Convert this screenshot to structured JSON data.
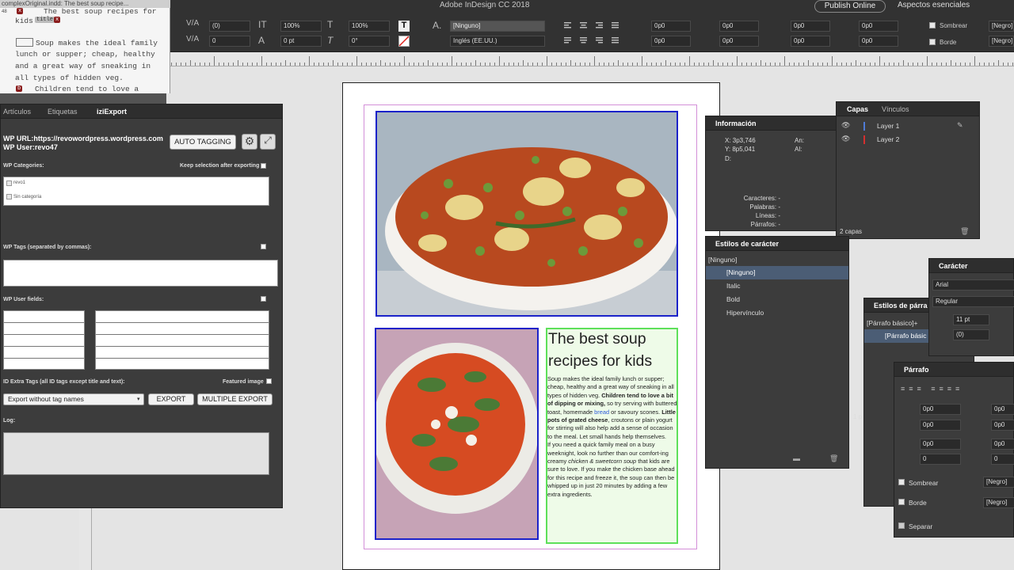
{
  "app": {
    "title": "Adobe InDesign CC 2018",
    "publish": "Publish Online",
    "workspace": "Aspectos esenciales"
  },
  "control": {
    "kern": "(0)",
    "track": "0",
    "scale_v": "100%",
    "scale_h": "100%",
    "baseline": "0 pt",
    "skew": "0°",
    "char_style": "[Ninguno]",
    "language": "Inglés (EE.UU.)",
    "indent_values": [
      "0p0",
      "0p0",
      "0p0",
      "0p0",
      "0p0",
      "0p0",
      "0p0",
      "0p0"
    ],
    "shade_label": "Sombrear",
    "border_label": "Borde",
    "color_label": "[Negro]"
  },
  "story_editor": {
    "title": "complexOriginal.indd: The best soup recipe...",
    "row0_number": "48",
    "lines": [
      "The best soup recipes for",
      "kids",
      "Soup makes the ideal family",
      "lunch or supper; cheap, healthy",
      "and a great way of sneaking in",
      "all types of hidden veg.",
      "Children tend to love a"
    ],
    "tags": {
      "title_tag": "title",
      "b_tag": "b"
    }
  },
  "izi": {
    "tabs": [
      "Artículos",
      "Etiquetas",
      "iziExport"
    ],
    "wp_url": "WP URL:https://revowordpress.wordpress.com",
    "wp_user": "WP User:revo47",
    "auto_tagging": "AUTO TAGGING",
    "categories_label": "WP Categories:",
    "keep_selection": "Keep selection after exporting",
    "categories": [
      "revo1",
      "Sin categoría"
    ],
    "tags_label": "WP Tags (separated by commas):",
    "user_fields_label": "WP User fields:",
    "extra_tags_label": "ID Extra Tags (all ID tags except title and text):",
    "featured_image": "Featured image",
    "export_select": "Export without tag names",
    "export_btn": "EXPORT",
    "multiple_export_btn": "MULTIPLE EXPORT",
    "log_label": "Log:"
  },
  "info": {
    "title": "Información",
    "x": "X: 3p3,746",
    "y": "Y: 8p5,041",
    "d": "D:",
    "an": "An:",
    "al": "Al:",
    "stats": [
      "Caracteres: -",
      "Palabras: -",
      "Líneas: -",
      "Párrafos: -"
    ]
  },
  "layers": {
    "tabs": [
      "Capas",
      "Vínculos"
    ],
    "items": [
      {
        "name": "Layer 1",
        "color": "#4f7bd6"
      },
      {
        "name": "Layer 2",
        "color": "#d62f2f"
      }
    ],
    "count": "2 capas"
  },
  "char_styles": {
    "title": "Estilos de carácter",
    "current": "[Ninguno]",
    "items": [
      "[Ninguno]",
      "Italic",
      "Bold",
      "Hipervínculo"
    ]
  },
  "caracter": {
    "title": "Carácter",
    "font": "Arial",
    "style": "Regular",
    "size": "11 pt",
    "kern": "(0)"
  },
  "para_styles": {
    "title": "Estilos de párra",
    "current": "[Párrafo básico]+",
    "selected": "[Párrafo básic"
  },
  "parrafo": {
    "title": "Párrafo",
    "values": [
      "0p0",
      "0p0",
      "0p0",
      "0p0",
      "0p0",
      "0p0",
      "0",
      "0"
    ],
    "shade": "Sombrear",
    "border": "Borde",
    "separate": "Separar",
    "color": "[Negro]"
  },
  "stray": {
    "label_1p": "1 p"
  },
  "doc": {
    "headline": "The best soup recipes for kids",
    "body": [
      {
        "t": "Soup makes the ideal family lunch or supper; cheap, healthy and a great way of sneaking in all types of hidden veg. "
      },
      {
        "t": "Children tend to love a bit of dipping or mixing,",
        "b": true
      },
      {
        "t": " so try serving with buttered toast, homemade "
      },
      {
        "t": "bread",
        "link": true
      },
      {
        "t": " or savoury scones. "
      },
      {
        "t": "Little pots of grated cheese",
        "b": true
      },
      {
        "t": ", croutons or plain yogurt for stirring will also help add a sense of occasion to the meal. Let small hands help themselves."
      }
    ],
    "body2": [
      {
        "t": "If you need a quick family meal on a busy weeknight, look no further than our comfort-ing creamy "
      },
      {
        "t": "chicken & sweetcorn soup",
        "i": true
      },
      {
        "t": " that kids are sure to love. If you make the chicken base ahead for this recipe and freeze it, the soup can then be whipped up in just 20 minutes by adding a few extra ingredients."
      }
    ]
  }
}
